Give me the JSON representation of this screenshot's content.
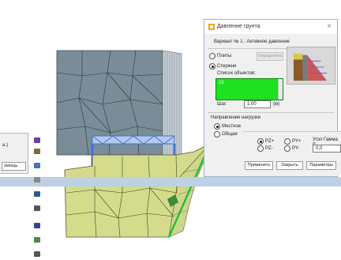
{
  "left_panel": {
    "label": "а.)",
    "button_label": "омощь"
  },
  "dialog": {
    "title": "Давление грунта",
    "variant": "Вариант № 1 : Активное давление",
    "radio_plates": "Плиты",
    "radio_rods": "Стержни",
    "define_button": "Определить",
    "objects_list_label": "Список объектов:",
    "objects_list_items": [
      "15"
    ],
    "step_label": "Шаг:",
    "step_value": "1,00",
    "step_unit": "(м)",
    "load_direction_label": "Направление нагрузки",
    "radio_local": "Местное",
    "radio_general": "Общая"
  },
  "bottom_panel": {
    "radio_pz_plus": "PZ+",
    "radio_pz_minus": "PZ-",
    "radio_py_plus": "PY+",
    "radio_py_minus": "PY-",
    "gamma_label": "Угол Гамма (г",
    "gamma_value": "0,0",
    "apply_button": "Применить",
    "close_button": "Закрыть",
    "params_button": "Параметры"
  },
  "colors": {
    "mesh_gray": "#7b8c99",
    "mesh_yellow": "#d4dc8c",
    "list_green": "#1fe11f",
    "selection_blue": "#3d74d8"
  }
}
